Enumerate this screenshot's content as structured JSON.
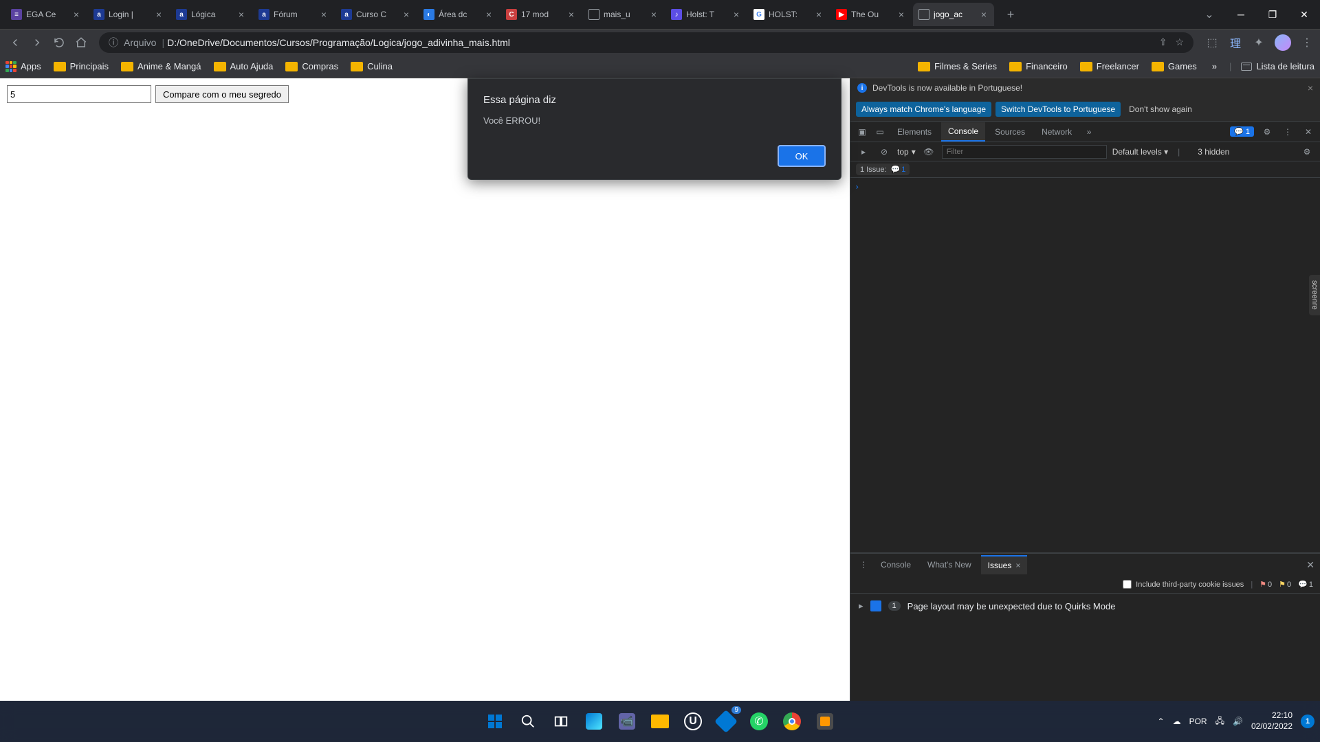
{
  "tabs": [
    {
      "title": "EGA Ce"
    },
    {
      "title": "Login |"
    },
    {
      "title": "Lógica"
    },
    {
      "title": "Fórum"
    },
    {
      "title": "Curso C"
    },
    {
      "title": "Área dc"
    },
    {
      "title": "17 mod"
    },
    {
      "title": "mais_u"
    },
    {
      "title": "Holst: T"
    },
    {
      "title": "HOLST:"
    },
    {
      "title": "The Ou"
    },
    {
      "title": "jogo_ac"
    }
  ],
  "active_tab_index": 11,
  "address": {
    "file_label": "Arquivo",
    "path": "D:/OneDrive/Documentos/Cursos/Programação/Logica/jogo_adivinha_mais.html"
  },
  "bookmarks": {
    "apps": "Apps",
    "items": [
      "Principais",
      "Anime & Mangá",
      "Auto Ajuda",
      "Compras",
      "Culina",
      "Filmes & Series",
      "Financeiro",
      "Freelancer",
      "Games"
    ],
    "more": "»",
    "reading_list": "Lista de leitura"
  },
  "page": {
    "input_value": "5",
    "button_label": "Compare com o meu segredo"
  },
  "alert": {
    "title": "Essa página diz",
    "message": "Você ERROU!",
    "ok": "OK"
  },
  "devtools": {
    "infobar": "DevTools is now available in Portuguese!",
    "lang_always": "Always match Chrome's language",
    "lang_switch": "Switch DevTools to Portuguese",
    "lang_dont": "Don't show again",
    "tabs": {
      "elements": "Elements",
      "console": "Console",
      "sources": "Sources",
      "network": "Network"
    },
    "issues_badge": "1",
    "toolbar": {
      "scope": "top",
      "filter_placeholder": "Filter",
      "levels": "Default levels",
      "hidden_count": "3 hidden"
    },
    "issues_row": {
      "label": "1 Issue:",
      "count": "1"
    },
    "drawer": {
      "tabs": {
        "console": "Console",
        "whatsnew": "What's New",
        "issues": "Issues"
      },
      "include_cookies": "Include third-party cookie issues",
      "counts": {
        "red": "0",
        "yellow": "0",
        "blue": "1"
      },
      "issue_text": "Page layout may be unexpected due to Quirks Mode",
      "issue_count": "1"
    }
  },
  "screenrec": "screenre",
  "taskbar": {
    "lang": "POR",
    "time": "22:10",
    "date": "02/02/2022",
    "notif": "1",
    "widget_badge": "9"
  }
}
